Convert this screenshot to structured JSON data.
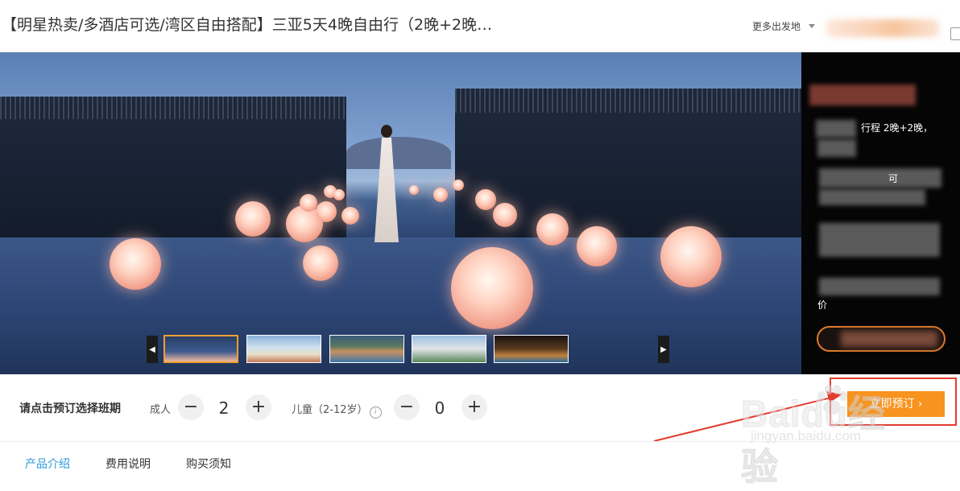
{
  "header": {
    "title": "【明星热卖/多酒店可选/湾区自由搭配】三亚5天4晚自由行（2晚+2晚…",
    "more_departure": "更多出发地"
  },
  "promo_panel": {
    "line_1": "行程  2晚+2晚，",
    "line_2": "可",
    "line_3": "价"
  },
  "booking": {
    "prompt": "请点击预订选择班期",
    "adult_label": "成人",
    "adult_count": "2",
    "child_label_pre": "儿童（2-12岁）",
    "child_count": "0",
    "minus": "−",
    "plus": "+",
    "book_button": "立即预订 ›"
  },
  "tabs": [
    {
      "label": "产品介绍"
    },
    {
      "label": "费用说明"
    },
    {
      "label": "购买须知"
    }
  ],
  "watermark": {
    "brand": "Baidu经验",
    "url": "jingyan.baidu.com"
  },
  "colors": {
    "accent_orange": "#f7931e",
    "active_tab_blue": "#2a9bdb",
    "annotation_red": "#e23b30"
  }
}
